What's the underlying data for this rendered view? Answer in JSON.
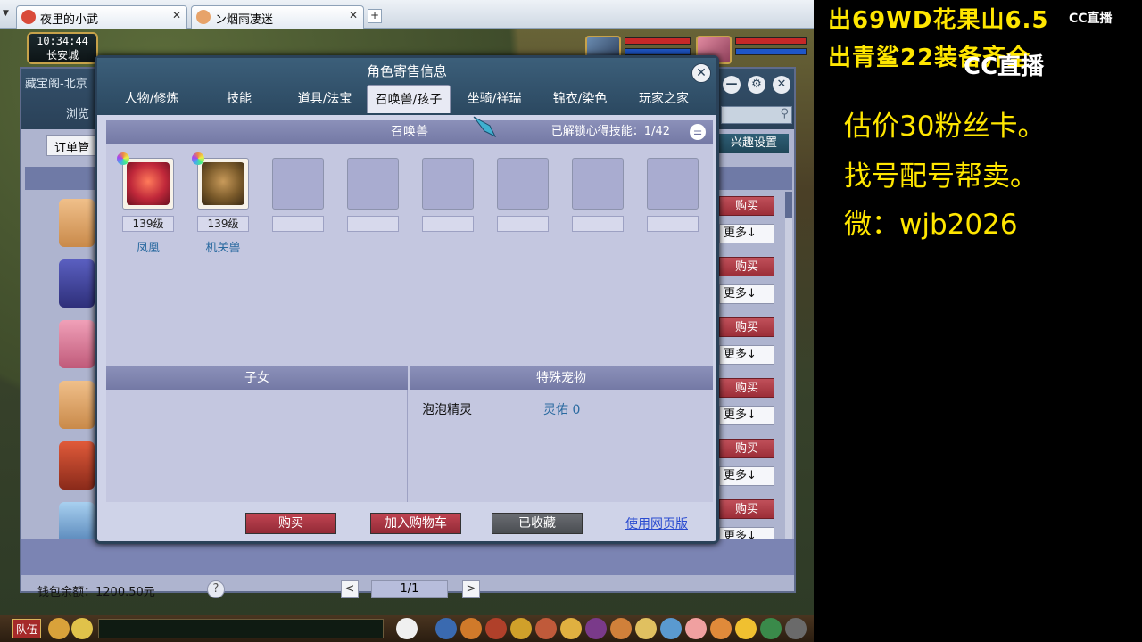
{
  "browser": {
    "tabs": [
      {
        "label": "夜里的小武"
      },
      {
        "label": "ン烟雨凄迷"
      }
    ],
    "new_tab": "+"
  },
  "hud": {
    "time": "10:34:44",
    "location": "长安城"
  },
  "cbg": {
    "title": "藏宝阁-北京",
    "browse": "浏览",
    "order_btn": "订单管",
    "interest_btn": "兴趣设置",
    "buy_label": "购买",
    "more_label": "更多↓",
    "wallet": "钱包余额：1200.50元",
    "help": "?",
    "page": "1/1",
    "prev": "<",
    "next": ">",
    "min": "—",
    "gear": "⚙",
    "close": "✕",
    "search_glyph": "⚲"
  },
  "dialog": {
    "title": "角色寄售信息",
    "close": "✕",
    "tabs": [
      {
        "label": "人物/修炼"
      },
      {
        "label": "技能"
      },
      {
        "label": "道具/法宝"
      },
      {
        "label": "召唤兽/孩子"
      },
      {
        "label": "坐骑/祥瑞"
      },
      {
        "label": "锦衣/染色"
      },
      {
        "label": "玩家之家"
      }
    ],
    "active_tab": "召唤兽/孩子",
    "summon_header": "召唤兽",
    "skill_unlock": "已解锁心得技能：1/42",
    "list_icon": "☰",
    "pets": [
      {
        "level": "139级",
        "name": "凤凰"
      },
      {
        "level": "139级",
        "name": "机关兽"
      }
    ],
    "children_header": "子女",
    "special_header": "特殊宠物",
    "special_pet": {
      "name": "泡泡精灵",
      "value": "灵佑 0"
    },
    "buttons": {
      "buy": "购买",
      "cart": "加入购物车",
      "favorited": "已收藏",
      "web": "使用网页版"
    }
  },
  "bottom": {
    "team": "队伍"
  },
  "overlay": {
    "line1": "出69WD花果山6.5",
    "line2": "出青鲨22装备齐全",
    "logo1": "CC直播",
    "logo2": "CC直播",
    "text1": "估价30粉丝卡。",
    "text2": "找号配号帮卖。",
    "text3": "微：wjb2026"
  },
  "colors": {
    "overlay_text": "#ffe600",
    "dialog_header": "#2b4860",
    "buy_button": "#a6323e",
    "link": "#2a4bd0"
  }
}
